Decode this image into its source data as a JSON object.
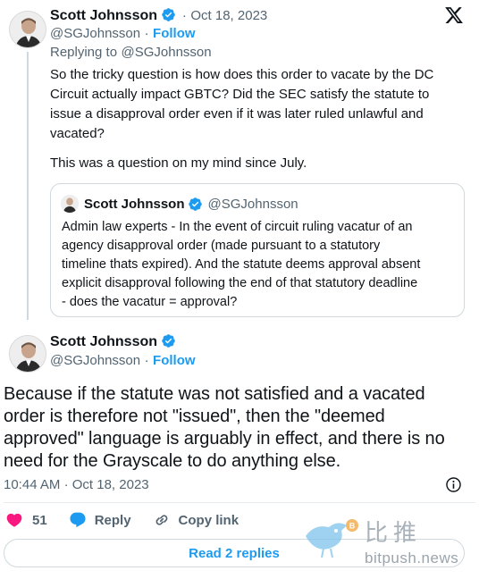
{
  "tweet1": {
    "author_name": "Scott Johnsson",
    "separator": "·",
    "date": "Oct 18, 2023",
    "handle": "@SGJohnsson",
    "handle_separator": "·",
    "follow_label": "Follow",
    "replying_prefix": "Replying to",
    "replying_handle": "@SGJohnsson",
    "text_lines": [
      "So the tricky question is how does this order to vacate by the DC",
      "Circuit actually impact GBTC? Did the SEC satisfy the statute to",
      "issue a disapproval order even if it was later ruled unlawful and",
      "vacated?"
    ],
    "text_line2": "This was a question on my mind since July.",
    "quoted": {
      "author_name": "Scott Johnsson",
      "handle": "@SGJohnsson",
      "text_lines": [
        "Admin law experts - In the event of circuit ruling vacatur of an",
        "agency disapproval order (made pursuant to a statutory",
        "timeline thats expired). And the statute deems approval absent",
        "explicit disapproval following the end of that statutory deadline",
        "- does the vacatur = approval?"
      ]
    }
  },
  "tweet2": {
    "author_name": "Scott Johnsson",
    "handle": "@SGJohnsson",
    "handle_separator": "·",
    "follow_label": "Follow",
    "text_lines": [
      "Because if the statute was not satisfied and a vacated",
      "order is therefore not \"issued\", then the \"deemed",
      "approved\" language is arguably in effect, and there is no",
      "need for the Grayscale to do anything else."
    ],
    "time": "10:44 AM",
    "time_separator": "·",
    "date": "Oct 18, 2023",
    "actions": {
      "likes_count": "51",
      "reply_label": "Reply",
      "copy_link_label": "Copy link"
    },
    "read_replies_label": "Read 2 replies"
  },
  "watermark": {
    "chinese": "比推",
    "domain": "bitpush.news"
  },
  "colors": {
    "accent": "#1d9bf0",
    "like": "#f91880",
    "text": "#0f1419",
    "muted": "#536471",
    "border": "#cfd9de"
  },
  "icons": [
    "x-logo-icon",
    "verified-badge-icon",
    "heart-icon",
    "reply-bubble-icon",
    "link-icon",
    "info-icon",
    "bird-watermark-icon"
  ]
}
